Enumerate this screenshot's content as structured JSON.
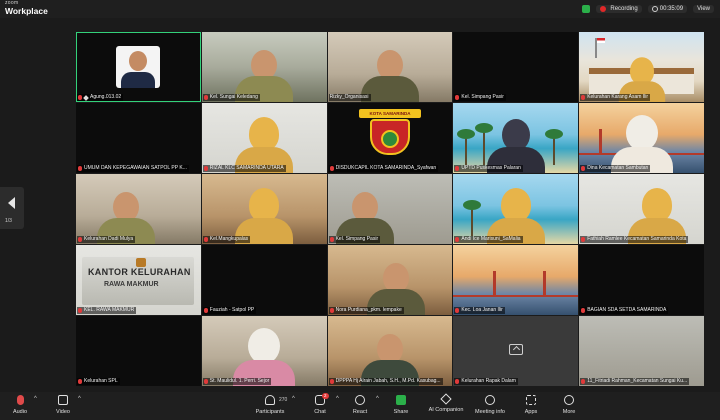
{
  "app": {
    "brand_top": "zoom",
    "brand_name": "Workplace"
  },
  "topbar": {
    "recording_label": "Recording",
    "timer": "00:35:09",
    "view_label": "View"
  },
  "nav": {
    "page_indicator": "1/3"
  },
  "tiles": [
    "Agung.013.02",
    "Kel. Sungai Keledang",
    "Rizky_Organisasi",
    "Kel. Simpang Pasir",
    "Kelurahan Karang Asam Ilir",
    "UMUM DAN KEPEGAWAIAN SATPOL PP K...",
    "RIZAL KLC SAMARINDA UTARA",
    "DISDUKCAPIL KOTA SAMARINDA_Syafwan",
    "UPTD Puskesmas Palaran",
    "Dina Kecamatan Sambutan",
    "Kelurahan Dadi Mulya",
    "Kel.Mangkupalas",
    "Kel. Simpang Pasir",
    "Andi Ice Marisuni_SaMalia",
    "Fathiah Ramlee Kecamatan Samarinda Kota",
    "KEL. RAWA MAKMUR",
    "Fauziah - Satpol PP",
    "Nora Purdiana_pkm. lempake",
    "Kec. Loa Janan Ilir",
    "BAGIAN SDA SETDA SAMARINDA",
    "Kelurahan SPL",
    "St. Maulidul. 1. Perri. Sejor",
    "DPPPA Hj Alrain Jabah, S.H., M.Pd. Kasubag...",
    "Kelurahan Rapak Dalam",
    "11_Fitriadi Rahman_Kecamatan Sungai Ku..."
  ],
  "tile_overlays": {
    "emblem_text": "KOTA SAMARINDA",
    "kantor_line1": "KANTOR KELURAHAN",
    "kantor_line2": "RAWA MAKMUR"
  },
  "toolbar": {
    "audio": "Audio",
    "video": "Video",
    "participants": "Participants",
    "participants_count": "270",
    "chat": "Chat",
    "chat_badge": "2",
    "react": "React",
    "share": "Share",
    "ai_companion": "AI Companion",
    "meeting_info": "Meeting info",
    "apps": "Apps",
    "more": "More"
  },
  "colors": {
    "active_border": "#33d17a",
    "share_green": "#2bb04a",
    "recording_red": "#e02828"
  }
}
